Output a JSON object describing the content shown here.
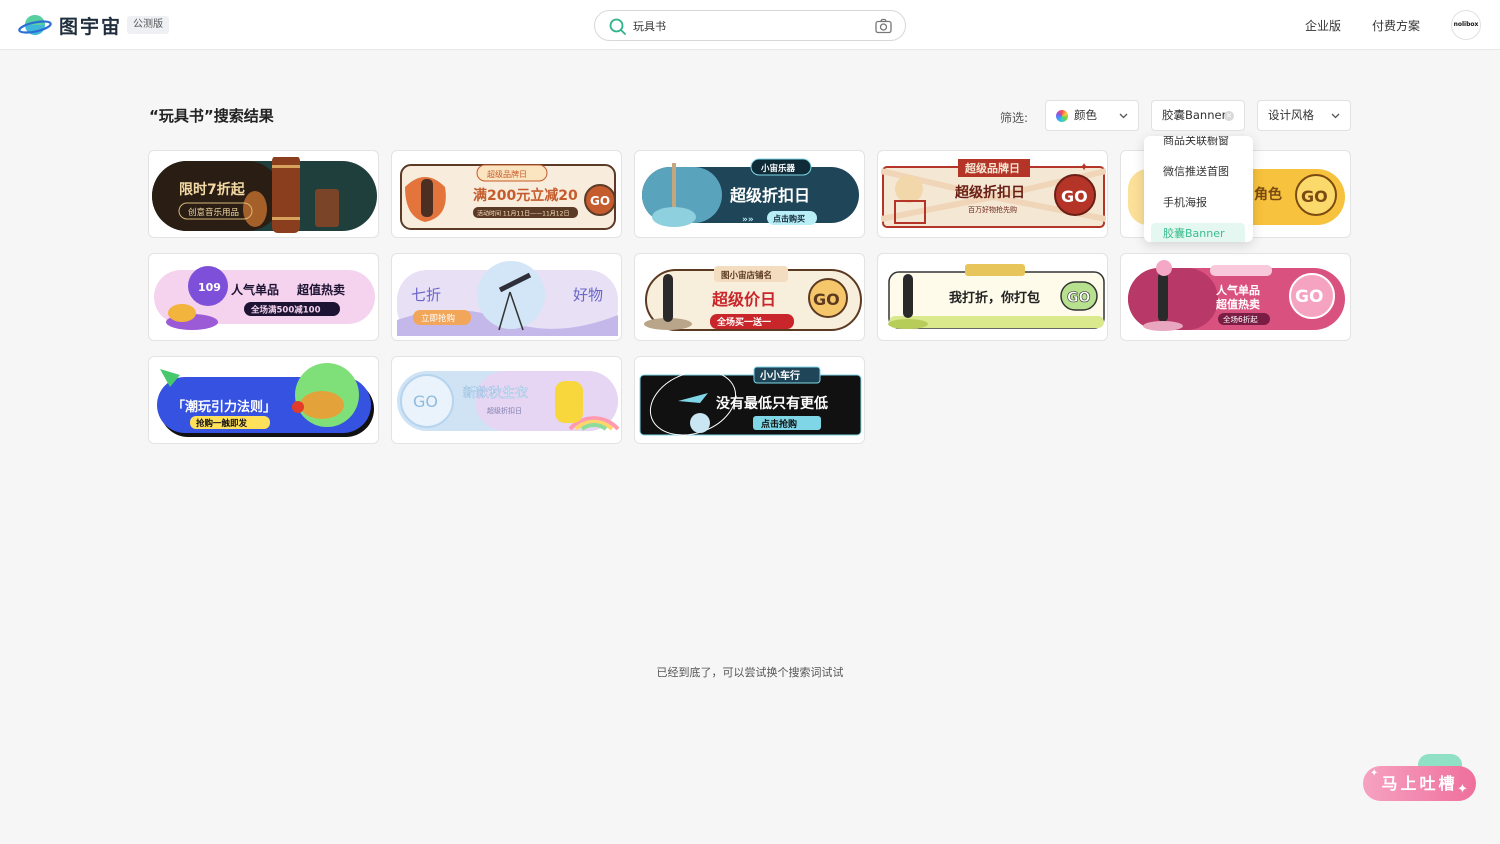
{
  "header": {
    "logo_text": "图宇宙",
    "beta_badge": "公测版",
    "search": {
      "value": "玩具书"
    },
    "nav": {
      "enterprise": "企业版",
      "pricing": "付费方案"
    },
    "avatar_text": "nolibox"
  },
  "results": {
    "title": "“玩具书”搜索结果",
    "filter_label": "筛选:",
    "filters": {
      "color": "颜色",
      "category": "胶囊Banner",
      "style": "设计风格"
    }
  },
  "dropdown": {
    "items": [
      "商品关联橱窗",
      "微信推送首图",
      "手机海报",
      "胶囊Banner"
    ],
    "active_index": 3
  },
  "banners": [
    {
      "main": "限时7折起",
      "sub": "创意音乐用品"
    },
    {
      "tag": "超级品牌日",
      "main": "满200元立减20",
      "sub": "活动时间 11月11日——11月12日",
      "cta": "GO"
    },
    {
      "tag": "小宙乐器",
      "main": "超级折扣日",
      "sub": "点击购买"
    },
    {
      "tag": "超级品牌日",
      "main": "超级折扣日",
      "sub": "百万好物抢先购",
      "cta": "GO"
    },
    {
      "main": "角色",
      "cta": "GO"
    },
    {
      "badge": "109",
      "main": "人气单品",
      "main2": "超值热卖",
      "sub": "全场满500减100"
    },
    {
      "main": "七折",
      "main2": "好物",
      "sub": "立即抢购"
    },
    {
      "tag": "图小宙店铺名",
      "main": "超级价日",
      "sub": "全场买一送一",
      "cta": "GO"
    },
    {
      "main": "我打折，你打包",
      "cta": "GO"
    },
    {
      "main": "人气单品",
      "main2": "超值热卖",
      "sub": "全场6折起",
      "cta": "GO"
    },
    {
      "main": "「潮玩引力法则」",
      "sub": "抢购一触即发"
    },
    {
      "cta": "GO",
      "main": "新款秋生衣",
      "sub": "超级折扣日"
    },
    {
      "tag": "小小车行",
      "main": "没有最低只有更低",
      "sub": "点击抢购"
    }
  ],
  "footer_text": "已经到底了，可以尝试换个搜索词试试",
  "feedback_label": "马上吐槽"
}
